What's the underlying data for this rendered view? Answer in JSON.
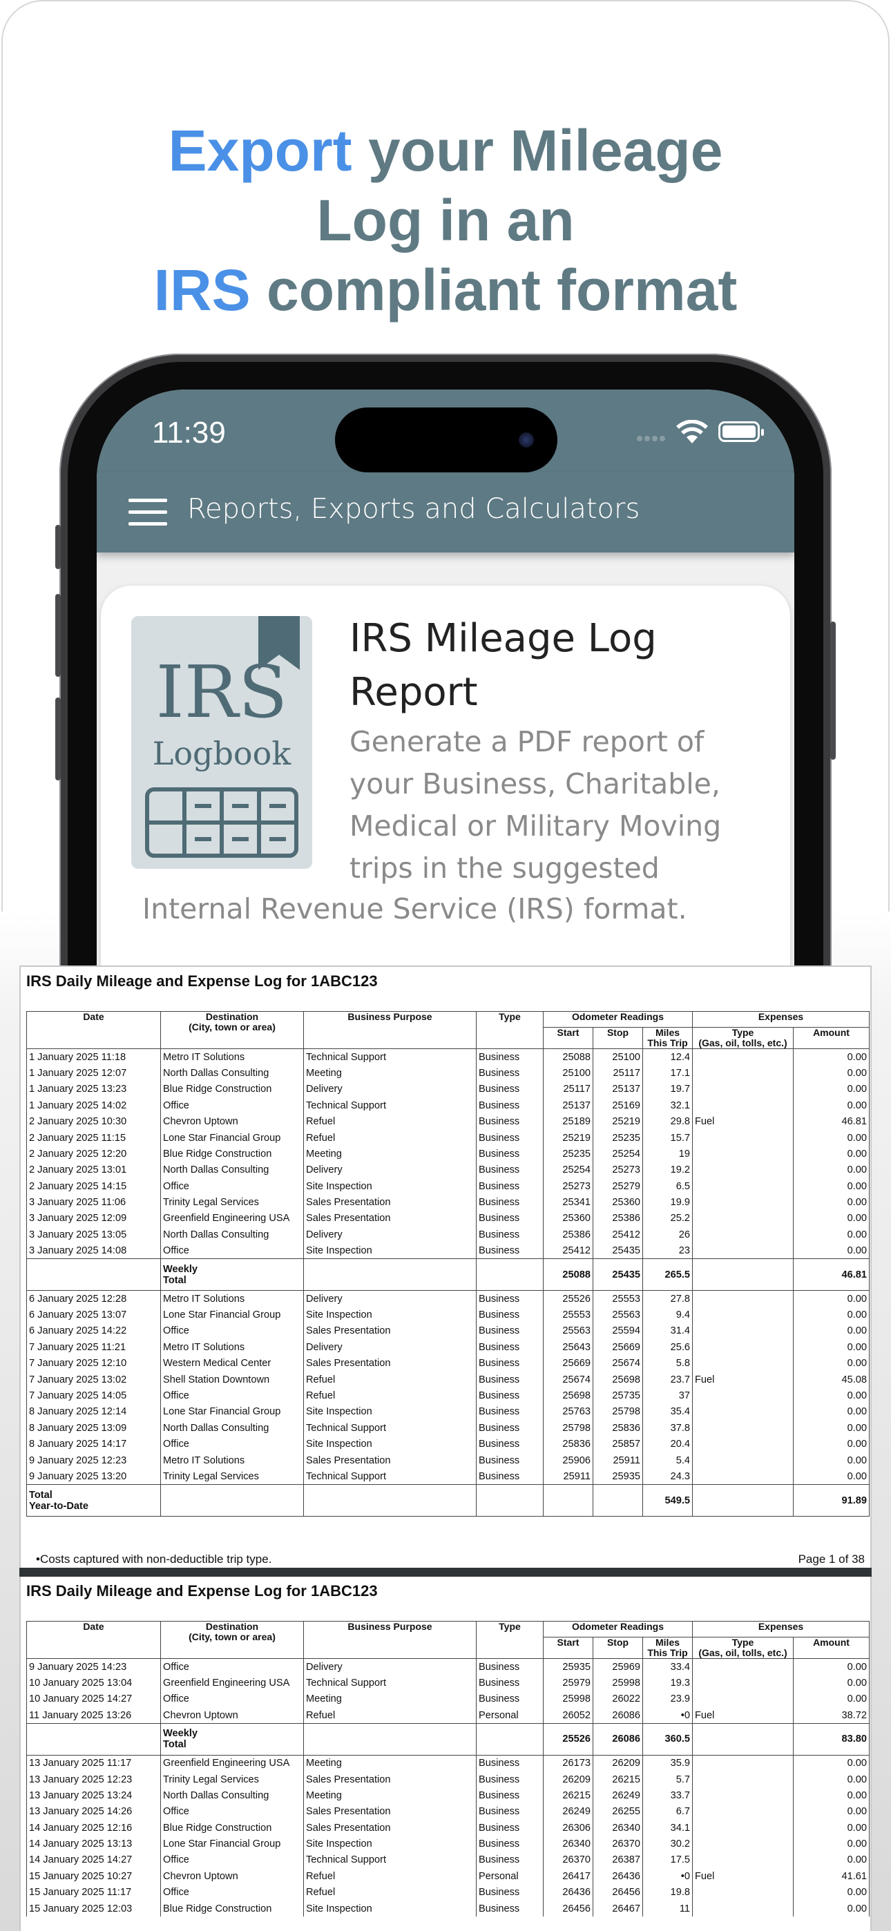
{
  "headline": {
    "line1_accent": "Export",
    "line1_rest": " your Mileage",
    "line2": "Log in an",
    "line3_accent": "IRS",
    "line3_rest": " compliant format",
    "accent_color": "#4a90e6",
    "main_color": "#5f7a83"
  },
  "status_bar": {
    "time": "11:39"
  },
  "app_header": {
    "title": "Reports, Exports and Calculators",
    "menu_icon": "hamburger-menu-icon",
    "color": "#5e7a84"
  },
  "report_card": {
    "logo_text": "IRS",
    "logo_subtext": "Logbook",
    "title": "IRS Mileage Log Report",
    "description_a": "Generate a PDF report of your Business, Charitable, Medical or Military Moving trips in the suggested",
    "description_b": "Internal Revenue Service (IRS) format."
  },
  "pdf": {
    "title": "IRS Daily Mileage and Expense Log for 1ABC123",
    "headers": {
      "date": "Date",
      "destination": "Destination",
      "destination_sub": "(City, town or area)",
      "purpose": "Business Purpose",
      "type": "Type",
      "odometer": "Odometer Readings",
      "start": "Start",
      "stop": "Stop",
      "miles": "Miles",
      "miles_sub": "This Trip",
      "expenses": "Expenses",
      "exp_type": "Type",
      "exp_type_sub": "(Gas, oil, tolls, etc.)",
      "amount": "Amount"
    },
    "weekly_label_1": "Weekly",
    "weekly_label_2": "Total",
    "total_label_1": "Total",
    "total_label_2": "Year-to-Date",
    "footnote": "•Costs captured with non-deductible trip type.",
    "page_label": "Page 1 of 38",
    "page1_rows": [
      [
        "1 January 2025 11:18",
        "Metro IT Solutions",
        "Technical Support",
        "Business",
        "25088",
        "25100",
        "12.4",
        "",
        "0.00"
      ],
      [
        "1 January 2025 12:07",
        "North Dallas Consulting",
        "Meeting",
        "Business",
        "25100",
        "25117",
        "17.1",
        "",
        "0.00"
      ],
      [
        "1 January 2025 13:23",
        "Blue Ridge Construction",
        "Delivery",
        "Business",
        "25117",
        "25137",
        "19.7",
        "",
        "0.00"
      ],
      [
        "1 January 2025 14:02",
        "Office",
        "Technical Support",
        "Business",
        "25137",
        "25169",
        "32.1",
        "",
        "0.00"
      ],
      [
        "2 January 2025 10:30",
        "Chevron Uptown",
        "Refuel",
        "Business",
        "25189",
        "25219",
        "29.8",
        "Fuel",
        "46.81"
      ],
      [
        "2 January 2025 11:15",
        "Lone Star Financial Group",
        "Refuel",
        "Business",
        "25219",
        "25235",
        "15.7",
        "",
        "0.00"
      ],
      [
        "2 January 2025 12:20",
        "Blue Ridge Construction",
        "Meeting",
        "Business",
        "25235",
        "25254",
        "19",
        "",
        "0.00"
      ],
      [
        "2 January 2025 13:01",
        "North Dallas Consulting",
        "Delivery",
        "Business",
        "25254",
        "25273",
        "19.2",
        "",
        "0.00"
      ],
      [
        "2 January 2025 14:15",
        "Office",
        "Site Inspection",
        "Business",
        "25273",
        "25279",
        "6.5",
        "",
        "0.00"
      ],
      [
        "3 January 2025 11:06",
        "Trinity Legal Services",
        "Sales Presentation",
        "Business",
        "25341",
        "25360",
        "19.9",
        "",
        "0.00"
      ],
      [
        "3 January 2025 12:09",
        "Greenfield Engineering USA",
        "Sales Presentation",
        "Business",
        "25360",
        "25386",
        "25.2",
        "",
        "0.00"
      ],
      [
        "3 January 2025 13:05",
        "North Dallas Consulting",
        "Delivery",
        "Business",
        "25386",
        "25412",
        "26",
        "",
        "0.00"
      ],
      [
        "3 January 2025 14:08",
        "Office",
        "Site Inspection",
        "Business",
        "25412",
        "25435",
        "23",
        "",
        "0.00"
      ]
    ],
    "page1_weekly": [
      "25088",
      "25435",
      "265.5",
      "46.81"
    ],
    "page1_rows_b": [
      [
        "6 January 2025 12:28",
        "Metro IT Solutions",
        "Delivery",
        "Business",
        "25526",
        "25553",
        "27.8",
        "",
        "0.00"
      ],
      [
        "6 January 2025 13:07",
        "Lone Star Financial Group",
        "Site Inspection",
        "Business",
        "25553",
        "25563",
        "9.4",
        "",
        "0.00"
      ],
      [
        "6 January 2025 14:22",
        "Office",
        "Sales Presentation",
        "Business",
        "25563",
        "25594",
        "31.4",
        "",
        "0.00"
      ],
      [
        "7 January 2025 11:21",
        "Metro IT Solutions",
        "Delivery",
        "Business",
        "25643",
        "25669",
        "25.6",
        "",
        "0.00"
      ],
      [
        "7 January 2025 12:10",
        "Western Medical Center",
        "Sales Presentation",
        "Business",
        "25669",
        "25674",
        "5.8",
        "",
        "0.00"
      ],
      [
        "7 January 2025 13:02",
        "Shell Station Downtown",
        "Refuel",
        "Business",
        "25674",
        "25698",
        "23.7",
        "Fuel",
        "45.08"
      ],
      [
        "7 January 2025 14:05",
        "Office",
        "Refuel",
        "Business",
        "25698",
        "25735",
        "37",
        "",
        "0.00"
      ],
      [
        "8 January 2025 12:14",
        "Lone Star Financial Group",
        "Site Inspection",
        "Business",
        "25763",
        "25798",
        "35.4",
        "",
        "0.00"
      ],
      [
        "8 January 2025 13:09",
        "North Dallas Consulting",
        "Technical Support",
        "Business",
        "25798",
        "25836",
        "37.8",
        "",
        "0.00"
      ],
      [
        "8 January 2025 14:17",
        "Office",
        "Site Inspection",
        "Business",
        "25836",
        "25857",
        "20.4",
        "",
        "0.00"
      ],
      [
        "9 January 2025 12:23",
        "Metro IT Solutions",
        "Sales Presentation",
        "Business",
        "25906",
        "25911",
        "5.4",
        "",
        "0.00"
      ],
      [
        "9 January 2025 13:20",
        "Trinity Legal Services",
        "Technical Support",
        "Business",
        "25911",
        "25935",
        "24.3",
        "",
        "0.00"
      ]
    ],
    "page1_total": [
      "549.5",
      "91.89"
    ],
    "page2_rows": [
      [
        "9 January 2025 14:23",
        "Office",
        "Delivery",
        "Business",
        "25935",
        "25969",
        "33.4",
        "",
        "0.00"
      ],
      [
        "10 January 2025 13:04",
        "Greenfield Engineering USA",
        "Technical Support",
        "Business",
        "25979",
        "25998",
        "19.3",
        "",
        "0.00"
      ],
      [
        "10 January 2025 14:27",
        "Office",
        "Meeting",
        "Business",
        "25998",
        "26022",
        "23.9",
        "",
        "0.00"
      ],
      [
        "11 January 2025 13:26",
        "Chevron Uptown",
        "Refuel",
        "Personal",
        "26052",
        "26086",
        "•0",
        "Fuel",
        "38.72"
      ]
    ],
    "page2_weekly": [
      "25526",
      "26086",
      "360.5",
      "83.80"
    ],
    "page2_rows_b": [
      [
        "13 January 2025 11:17",
        "Greenfield Engineering USA",
        "Meeting",
        "Business",
        "26173",
        "26209",
        "35.9",
        "",
        "0.00"
      ],
      [
        "13 January 2025 12:23",
        "Trinity Legal Services",
        "Sales Presentation",
        "Business",
        "26209",
        "26215",
        "5.7",
        "",
        "0.00"
      ],
      [
        "13 January 2025 13:24",
        "North Dallas Consulting",
        "Meeting",
        "Business",
        "26215",
        "26249",
        "33.7",
        "",
        "0.00"
      ],
      [
        "13 January 2025 14:26",
        "Office",
        "Sales Presentation",
        "Business",
        "26249",
        "26255",
        "6.7",
        "",
        "0.00"
      ],
      [
        "14 January 2025 12:16",
        "Blue Ridge Construction",
        "Sales Presentation",
        "Business",
        "26306",
        "26340",
        "34.1",
        "",
        "0.00"
      ],
      [
        "14 January 2025 13:13",
        "Lone Star Financial Group",
        "Site Inspection",
        "Business",
        "26340",
        "26370",
        "30.2",
        "",
        "0.00"
      ],
      [
        "14 January 2025 14:27",
        "Office",
        "Technical Support",
        "Business",
        "26370",
        "26387",
        "17.5",
        "",
        "0.00"
      ],
      [
        "15 January 2025 10:27",
        "Chevron Uptown",
        "Refuel",
        "Personal",
        "26417",
        "26436",
        "•0",
        "Fuel",
        "41.61"
      ],
      [
        "15 January 2025 11:17",
        "Office",
        "Refuel",
        "Business",
        "26436",
        "26456",
        "19.8",
        "",
        "0.00"
      ],
      [
        "15 January 2025 12:03",
        "Blue Ridge Construction",
        "Site Inspection",
        "Business",
        "26456",
        "26467",
        "11",
        "",
        "0.00"
      ]
    ]
  }
}
